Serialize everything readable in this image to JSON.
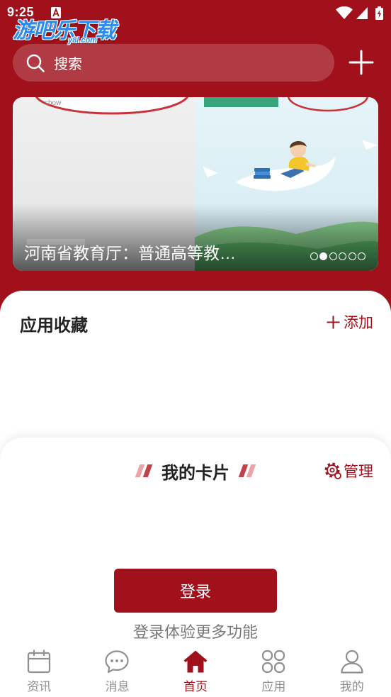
{
  "colors": {
    "brand": "#a0111c",
    "brand_light": "#e9a4a9",
    "muted": "#8f8f8f",
    "text_dark": "#222222"
  },
  "status_bar": {
    "time": "9:25",
    "left_icons": [
      "notification-icon"
    ],
    "right_icons": [
      "wifi-icon",
      "signal-icon",
      "battery-icon"
    ]
  },
  "watermark": {
    "name": "游吧乐下载",
    "domain": "y8l.com"
  },
  "search": {
    "placeholder": "搜索",
    "icon": "search-icon",
    "add_icon": "plus-icon"
  },
  "banner": {
    "caption": "河南省教育厅：普通高等教…",
    "image_text": "show",
    "slide_count": 6,
    "active_slide": 1
  },
  "favorites": {
    "title": "应用收藏",
    "add_label": "添加",
    "add_icon": "plus-icon"
  },
  "cards": {
    "title": "我的卡片",
    "manage_label": "管理",
    "manage_icon": "gear-icon",
    "login_button": "登录",
    "login_hint": "登录体验更多功能"
  },
  "bottom_nav": [
    {
      "label": "资讯",
      "icon": "calendar-icon",
      "active": false
    },
    {
      "label": "消息",
      "icon": "chat-icon",
      "active": false
    },
    {
      "label": "首页",
      "icon": "home-icon",
      "active": true
    },
    {
      "label": "应用",
      "icon": "apps-icon",
      "active": false
    },
    {
      "label": "我的",
      "icon": "user-icon",
      "active": false
    }
  ]
}
